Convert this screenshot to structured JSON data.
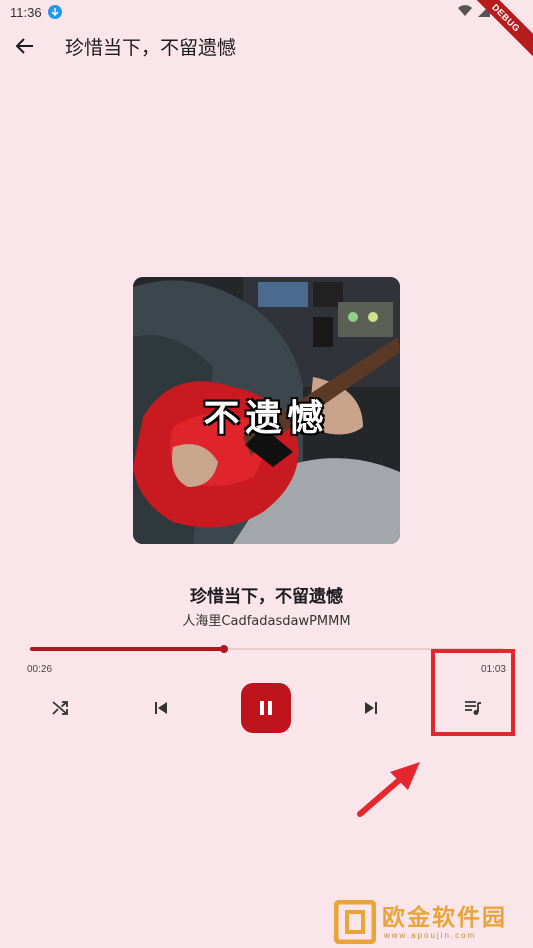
{
  "status_bar": {
    "time": "11:36",
    "debug_label": "DEBUG"
  },
  "appbar": {
    "title": "珍惜当下，不留遗憾"
  },
  "cover": {
    "overlay_text": "不遗憾"
  },
  "song": {
    "title": "珍惜当下，不留遗憾",
    "artist": "人海里CadfadasdawPMMM"
  },
  "player": {
    "elapsed": "00:26",
    "duration": "01:03",
    "progress_fraction": 0.41
  },
  "colors": {
    "accent": "#c0141c",
    "background": "#fae6ea",
    "highlight": "#e5262d"
  },
  "icons": {
    "back": "arrow-back-icon",
    "shuffle": "shuffle-icon",
    "previous": "skip-previous-icon",
    "pause": "pause-icon",
    "next": "skip-next-icon",
    "queue": "queue-music-icon"
  },
  "watermark": {
    "brand": "欧金软件园",
    "url": "www.apoujin.com"
  }
}
